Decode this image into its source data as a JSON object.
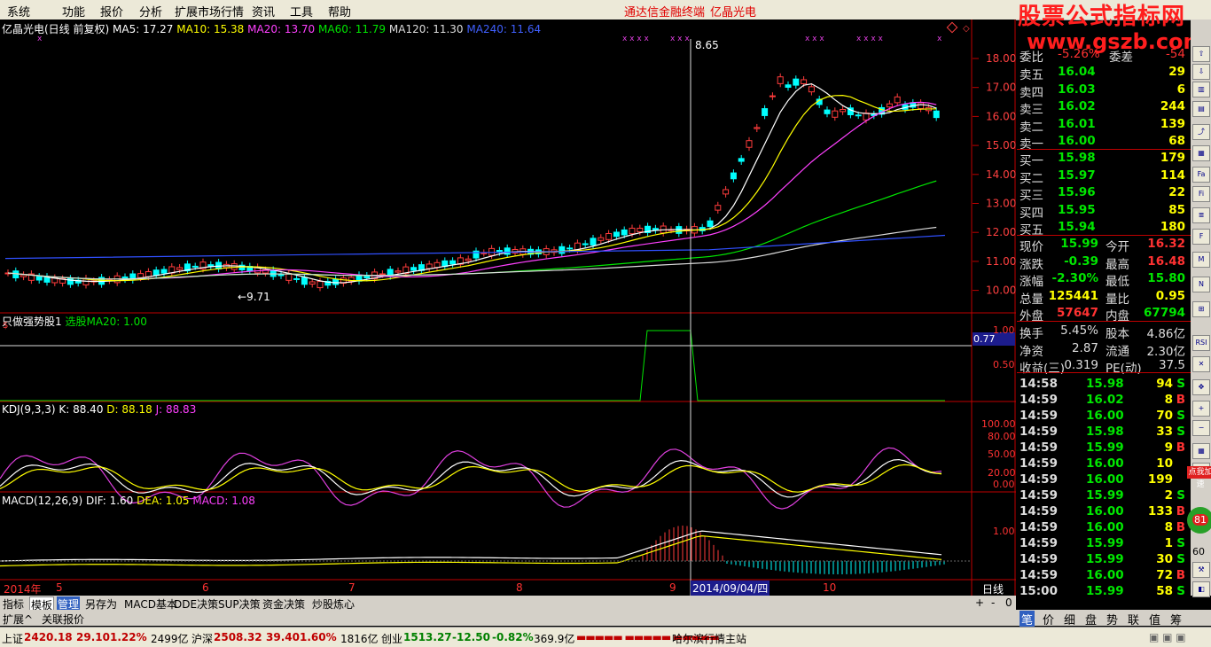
{
  "menu": [
    "系统",
    "功能",
    "报价",
    "分析",
    "扩展市场行情",
    "资讯",
    "工具",
    "帮助"
  ],
  "app_title": "通达信金融终端",
  "stock_title": "亿晶光电",
  "watermark": {
    "line1": "股票公式指标网",
    "line2": "www.gszb.com"
  },
  "main_chart": {
    "label": "亿晶光电(日线 前复权)",
    "ma5": "MA5: 17.27",
    "ma10": "MA10: 15.38",
    "ma20": "MA20: 13.70",
    "ma60": "MA60: 11.79",
    "ma120": "MA120: 11.30",
    "ma240": "MA240: 11.64",
    "high_mark": "8.65",
    "low_mark": "9.71",
    "y_ticks": [
      "18.00",
      "17.00",
      "16.00",
      "15.00",
      "14.00",
      "13.00",
      "12.00",
      "11.00",
      "10.00"
    ]
  },
  "indicator1": {
    "label": "只做强势股1",
    "value": "选股MA20: 1.00",
    "y_ticks": [
      "1.00",
      "0.50"
    ],
    "current": "0.77"
  },
  "kdj": {
    "label": "KDJ(9,3,3)",
    "k": "K: 88.40",
    "d": "D: 88.18",
    "j": "J: 88.83",
    "y_ticks": [
      "100.00",
      "80.00",
      "50.00",
      "20.00",
      "0.00"
    ]
  },
  "macd": {
    "label": "MACD(12,26,9)",
    "dif": "DIF: 1.60",
    "dea": "DEA: 1.05",
    "macd": "MACD: 1.08",
    "y_ticks": [
      "1.00"
    ]
  },
  "time_axis": {
    "year": "2014年",
    "months": [
      "5",
      "6",
      "7",
      "8",
      "9",
      "10"
    ],
    "cursor_date": "2014/09/04/四",
    "period": "日线"
  },
  "tabs": [
    "指标",
    "模板",
    "管理",
    "另存为",
    "MACD基本",
    "DDE决策",
    "SUP决策",
    "资金决策",
    "炒股炼心"
  ],
  "tabs_bottom": [
    "扩展^",
    "关联报价"
  ],
  "quote": {
    "top_partial": {
      "label": "委比",
      "value": "-5.26%",
      "label2": "委差",
      "value2": "-54"
    },
    "asks": [
      {
        "label": "卖五",
        "price": "16.04",
        "vol": "29"
      },
      {
        "label": "卖四",
        "price": "16.03",
        "vol": "6"
      },
      {
        "label": "卖三",
        "price": "16.02",
        "vol": "244"
      },
      {
        "label": "卖二",
        "price": "16.01",
        "vol": "139"
      },
      {
        "label": "卖一",
        "price": "16.00",
        "vol": "68"
      }
    ],
    "bids": [
      {
        "label": "买一",
        "price": "15.98",
        "vol": "179"
      },
      {
        "label": "买二",
        "price": "15.97",
        "vol": "114"
      },
      {
        "label": "买三",
        "price": "15.96",
        "vol": "22"
      },
      {
        "label": "买四",
        "price": "15.95",
        "vol": "85"
      },
      {
        "label": "买五",
        "price": "15.94",
        "vol": "180"
      }
    ],
    "stats": [
      {
        "l1": "现价",
        "v1": "15.99",
        "l2": "今开",
        "v2": "16.32"
      },
      {
        "l1": "涨跌",
        "v1": "-0.39",
        "l2": "最高",
        "v2": "16.48"
      },
      {
        "l1": "涨幅",
        "v1": "-2.30%",
        "l2": "最低",
        "v2": "15.80"
      },
      {
        "l1": "总量",
        "v1": "125441",
        "l2": "量比",
        "v2": "0.95"
      },
      {
        "l1": "外盘",
        "v1": "57647",
        "l2": "内盘",
        "v2": "67794"
      }
    ],
    "fin": [
      {
        "l1": "换手",
        "v1": "5.45%",
        "l2": "股本",
        "v2": "4.86亿"
      },
      {
        "l1": "净资",
        "v1": "2.87",
        "l2": "流通",
        "v2": "2.30亿"
      },
      {
        "l1": "收益(三)",
        "v1": "0.319",
        "l2": "PE(动)",
        "v2": "37.5"
      }
    ],
    "ticks": [
      {
        "t": "14:58",
        "p": "15.98",
        "v": "94",
        "s": "S"
      },
      {
        "t": "14:59",
        "p": "16.02",
        "v": "8",
        "s": "B"
      },
      {
        "t": "14:59",
        "p": "16.00",
        "v": "70",
        "s": "S"
      },
      {
        "t": "14:59",
        "p": "15.98",
        "v": "33",
        "s": "S"
      },
      {
        "t": "14:59",
        "p": "15.99",
        "v": "9",
        "s": "B"
      },
      {
        "t": "14:59",
        "p": "16.00",
        "v": "10",
        "s": ""
      },
      {
        "t": "14:59",
        "p": "16.00",
        "v": "199",
        "s": ""
      },
      {
        "t": "14:59",
        "p": "15.99",
        "v": "2",
        "s": "S"
      },
      {
        "t": "14:59",
        "p": "16.00",
        "v": "133",
        "s": "B"
      },
      {
        "t": "14:59",
        "p": "16.00",
        "v": "8",
        "s": "B"
      },
      {
        "t": "14:59",
        "p": "15.99",
        "v": "1",
        "s": "S"
      },
      {
        "t": "14:59",
        "p": "15.99",
        "v": "30",
        "s": "S"
      },
      {
        "t": "14:59",
        "p": "16.00",
        "v": "72",
        "s": "B"
      },
      {
        "t": "15:00",
        "p": "15.99",
        "v": "58",
        "s": "S"
      }
    ]
  },
  "right_tabs": [
    "笔",
    "价",
    "细",
    "盘",
    "势",
    "联",
    "值",
    "筹"
  ],
  "side_badge": "点我加速",
  "side_num": "81",
  "side_num2": "60",
  "status": {
    "sh_label": "上证",
    "sh_val": "2420.18",
    "sh_chg": "29.10",
    "sh_pct": "1.22%",
    "sh_amt": "2499亿",
    "sz_label": "沪深",
    "sz_val": "2508.32",
    "sz_chg": "39.40",
    "sz_pct": "1.60%",
    "sz_amt": "1816亿",
    "cy_label": "创业",
    "cy_val": "1513.27",
    "cy_chg": "-12.50",
    "cy_pct": "-0.82%",
    "cy_amt": "369.9亿",
    "site": "哈尔滨行情主站"
  }
}
